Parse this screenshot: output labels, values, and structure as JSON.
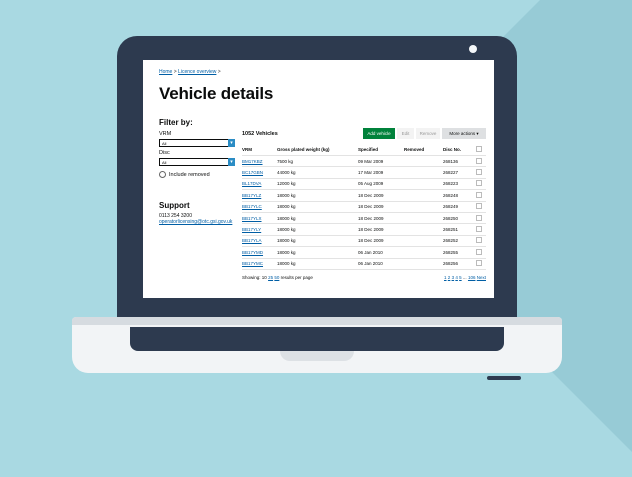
{
  "breadcrumb": {
    "home": "Home",
    "sep1": ">",
    "licence": "Licence overview",
    "sep2": ">"
  },
  "page_title": "Vehicle details",
  "filter": {
    "title": "Filter by:",
    "vrm_label": "VRM",
    "vrm_value": "All",
    "disc_label": "Disc",
    "disc_value": "All",
    "include_removed": "Include removed"
  },
  "support": {
    "title": "Support",
    "phone": "0113 254 3200",
    "email": "operatorlicensing@otc.gsi.gov.uk"
  },
  "table_header": {
    "count": "1052 Vehicles",
    "add": "Add vehicle",
    "edit": "Edit",
    "remove": "Remove",
    "more": "More actions",
    "more_arrow": "▾"
  },
  "columns": [
    "VRM",
    "Gross plated weight (kg)",
    "Specified",
    "Removed",
    "Disc No."
  ],
  "rows": [
    {
      "vrm": "BM17KBZ",
      "weight": "7500 kg",
      "specified": "09 Mar 2009",
      "removed": "",
      "disc": "268136"
    },
    {
      "vrm": "BC17GBN",
      "weight": "44000 kg",
      "specified": "17 Mar 2009",
      "removed": "",
      "disc": "268227"
    },
    {
      "vrm": "BL17DVA",
      "weight": "12000 kg",
      "specified": "05 Aug 2009",
      "removed": "",
      "disc": "268223"
    },
    {
      "vrm": "BB17YLZ",
      "weight": "18000 kg",
      "specified": "18 Dec 2009",
      "removed": "",
      "disc": "268248"
    },
    {
      "vrm": "BB17YLC",
      "weight": "18000 kg",
      "specified": "18 Dec 2009",
      "removed": "",
      "disc": "268249"
    },
    {
      "vrm": "BB17YLX",
      "weight": "18000 kg",
      "specified": "18 Dec 2009",
      "removed": "",
      "disc": "268250"
    },
    {
      "vrm": "BB17YLY",
      "weight": "18000 kg",
      "specified": "18 Dec 2009",
      "removed": "",
      "disc": "268251"
    },
    {
      "vrm": "BB17YLA",
      "weight": "18000 kg",
      "specified": "18 Dec 2009",
      "removed": "",
      "disc": "268252"
    },
    {
      "vrm": "BB17YMD",
      "weight": "18000 kg",
      "specified": "06 Jan 2010",
      "removed": "",
      "disc": "268255"
    },
    {
      "vrm": "BB17YMC",
      "weight": "18000 kg",
      "specified": "06 Jan 2010",
      "removed": "",
      "disc": "268256"
    }
  ],
  "footer": {
    "showing": "Showing:",
    "per_page": [
      "10",
      "25",
      "50"
    ],
    "per_page_suffix": "results per page",
    "pages": [
      "1",
      "2",
      "3",
      "4",
      "5",
      "...",
      "106",
      "Next"
    ]
  },
  "colors": {
    "lid": "#2d3a4f",
    "background": "#a9d9e2",
    "primary_button": "#00823b",
    "link": "#005ea5"
  }
}
